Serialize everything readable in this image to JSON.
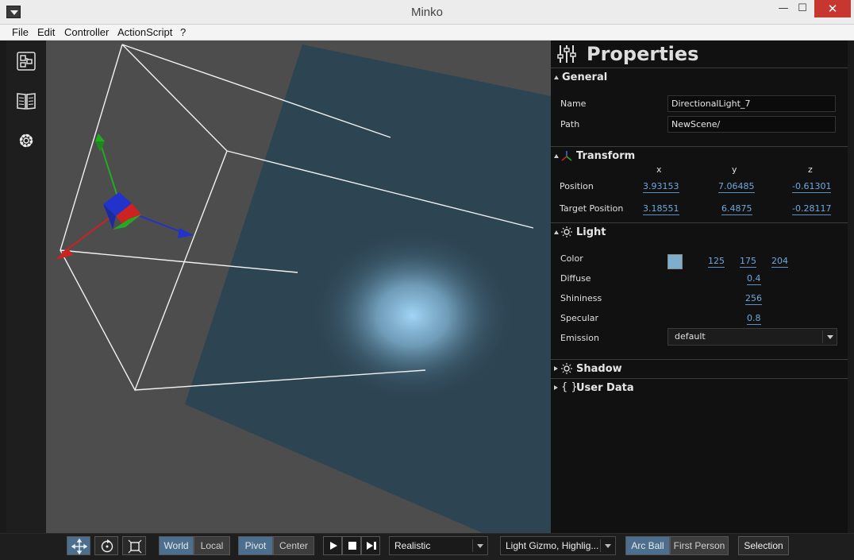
{
  "window": {
    "title": "Minko",
    "menu_icon": "dropdown-triangle",
    "min_icon": "minimize-icon",
    "max_icon": "maximize-icon",
    "close_icon": "close-icon",
    "min_glyph": "—",
    "max_glyph": "☐",
    "close_glyph": "✕"
  },
  "menubar": {
    "items": [
      "File",
      "Edit",
      "Controller",
      "ActionScript",
      "?"
    ]
  },
  "left_toolbar": {
    "icons": [
      "scene-graph-icon",
      "library-icon",
      "settings-gear-icon"
    ]
  },
  "properties": {
    "title": "Properties",
    "general": {
      "title": "General",
      "name_label": "Name",
      "name_value": "DirectionalLight_7",
      "path_label": "Path",
      "path_value": "NewScene/"
    },
    "transform": {
      "title": "Transform",
      "axes": [
        "x",
        "y",
        "z"
      ],
      "position_label": "Position",
      "position": [
        "3.93153",
        "7.06485",
        "-0.61301"
      ],
      "target_label": "Target Position",
      "target": [
        "3.18551",
        "6.4875",
        "-0.28117"
      ]
    },
    "light": {
      "title": "Light",
      "color_label": "Color",
      "color_hex": "#7dafcc",
      "color_r": "125",
      "color_g": "175",
      "color_b": "204",
      "diffuse_label": "Diffuse",
      "diffuse": "0.4",
      "shininess_label": "Shininess",
      "shininess": "256",
      "specular_label": "Specular",
      "specular": "0.8",
      "emission_label": "Emission",
      "emission": "default"
    },
    "shadow": {
      "title": "Shadow"
    },
    "user_data": {
      "title": "User Data",
      "icon_glyph": "{ }"
    }
  },
  "bottom_toolbar": {
    "space": {
      "world": "World",
      "local": "Local"
    },
    "pivot": {
      "pivot": "Pivot",
      "center": "Center"
    },
    "render_mode": "Realistic",
    "gizmo_filter": "Light Gizmo, Highlig...",
    "camera": {
      "arc_ball": "Arc Ball",
      "first_person": "First Person"
    },
    "selection": "Selection"
  },
  "colors": {
    "accent_active": "#4d6f8f",
    "number_link": "#6fa8dc",
    "axis_x": "#cc2222",
    "axis_y": "#22aa22",
    "axis_z": "#2233cc"
  }
}
